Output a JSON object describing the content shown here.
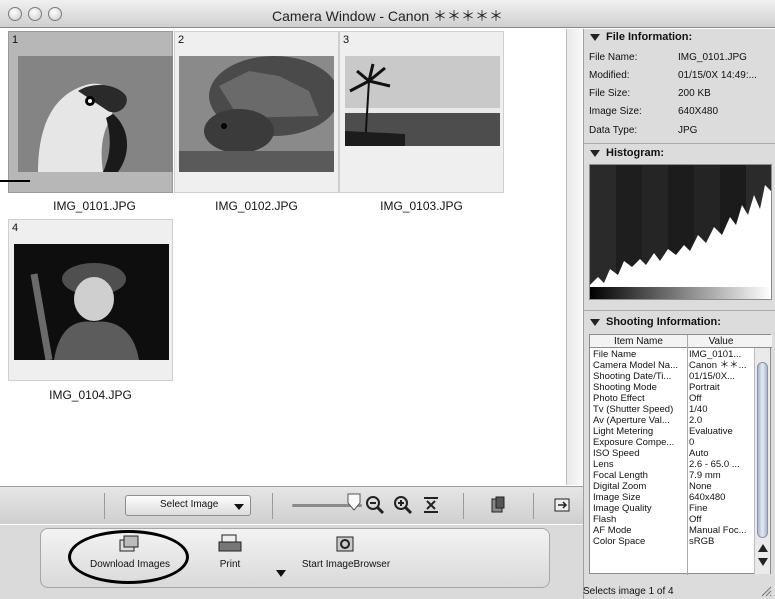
{
  "window": {
    "title": "Camera Window - Canon ＊＊＊＊＊"
  },
  "thumbnails": [
    {
      "number": "1",
      "filename": "IMG_0101.JPG"
    },
    {
      "number": "2",
      "filename": "IMG_0102.JPG"
    },
    {
      "number": "3",
      "filename": "IMG_0103.JPG"
    },
    {
      "number": "4",
      "filename": "IMG_0104.JPG"
    }
  ],
  "toolbar": {
    "select_label": "Select Image",
    "icons": [
      "zoom-out-icon",
      "zoom-in-icon",
      "fit-icon",
      "delete-icon",
      "export-icon"
    ]
  },
  "actions": {
    "download_label": "Download Images",
    "print_label": "Print",
    "start_browser_label": "Start ImageBrowser"
  },
  "file_info": {
    "header": "File Information:",
    "rows": [
      {
        "key": "File Name:",
        "value": "IMG_0101.JPG"
      },
      {
        "key": "Modified:",
        "value": "01/15/0X 14:49:..."
      },
      {
        "key": "File Size:",
        "value": "200 KB"
      },
      {
        "key": "Image Size:",
        "value": "640X480"
      },
      {
        "key": "Data Type:",
        "value": "JPG"
      }
    ]
  },
  "histogram": {
    "header": "Histogram:"
  },
  "shooting_info": {
    "header": "Shooting Information:",
    "col_name": "Item Name",
    "col_value": "Value",
    "rows": [
      {
        "name": "File Name",
        "value": "IMG_0101..."
      },
      {
        "name": "Camera Model Na...",
        "value": "Canon ＊＊..."
      },
      {
        "name": "Shooting Date/Ti...",
        "value": "01/15/0X..."
      },
      {
        "name": "Shooting Mode",
        "value": "Portrait"
      },
      {
        "name": "Photo Effect",
        "value": "Off"
      },
      {
        "name": "Tv (Shutter Speed)",
        "value": "1/40"
      },
      {
        "name": "Av (Aperture Val...",
        "value": "2.0"
      },
      {
        "name": "Light Metering",
        "value": "Evaluative"
      },
      {
        "name": "Exposure Compe...",
        "value": "0"
      },
      {
        "name": "ISO Speed",
        "value": "Auto"
      },
      {
        "name": "Lens",
        "value": "2.6 - 65.0 ..."
      },
      {
        "name": "Focal Length",
        "value": "7.9 mm"
      },
      {
        "name": "Digital Zoom",
        "value": "None"
      },
      {
        "name": "Image Size",
        "value": "640x480"
      },
      {
        "name": "Image Quality",
        "value": "Fine"
      },
      {
        "name": "Flash",
        "value": "Off"
      },
      {
        "name": "AF Mode",
        "value": "Manual Foc..."
      },
      {
        "name": "Color Space",
        "value": "sRGB"
      }
    ]
  },
  "status": {
    "text": "Selects image 1 of 4"
  }
}
